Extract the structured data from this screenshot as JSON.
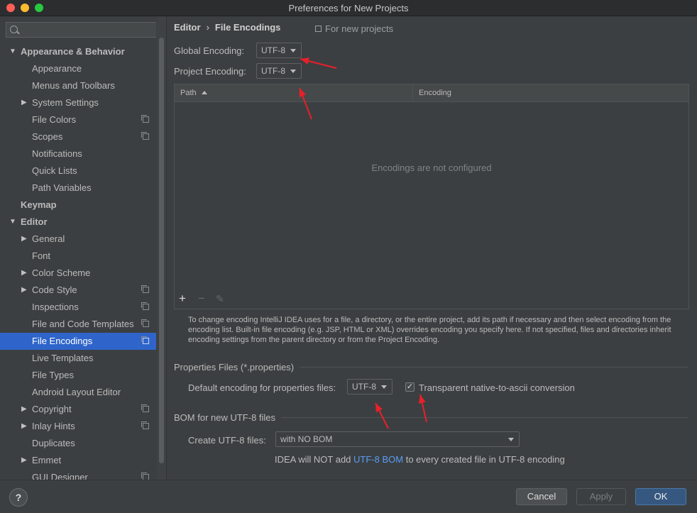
{
  "window": {
    "title": "Preferences for New Projects"
  },
  "search": {
    "placeholder": ""
  },
  "sidebar": {
    "items": [
      {
        "label": "Appearance & Behavior",
        "level": 0,
        "expanded": true,
        "bold": true
      },
      {
        "label": "Appearance",
        "level": 1
      },
      {
        "label": "Menus and Toolbars",
        "level": 1
      },
      {
        "label": "System Settings",
        "level": 1,
        "collapsed": true
      },
      {
        "label": "File Colors",
        "level": 1,
        "copy": true
      },
      {
        "label": "Scopes",
        "level": 1,
        "copy": true
      },
      {
        "label": "Notifications",
        "level": 1
      },
      {
        "label": "Quick Lists",
        "level": 1
      },
      {
        "label": "Path Variables",
        "level": 1
      },
      {
        "label": "Keymap",
        "level": 0,
        "bold": true
      },
      {
        "label": "Editor",
        "level": 0,
        "expanded": true,
        "bold": true
      },
      {
        "label": "General",
        "level": 1,
        "collapsed": true
      },
      {
        "label": "Font",
        "level": 1
      },
      {
        "label": "Color Scheme",
        "level": 1,
        "collapsed": true
      },
      {
        "label": "Code Style",
        "level": 1,
        "collapsed": true,
        "copy": true
      },
      {
        "label": "Inspections",
        "level": 1,
        "copy": true
      },
      {
        "label": "File and Code Templates",
        "level": 1,
        "copy": true
      },
      {
        "label": "File Encodings",
        "level": 1,
        "copy": true,
        "selected": true
      },
      {
        "label": "Live Templates",
        "level": 1
      },
      {
        "label": "File Types",
        "level": 1
      },
      {
        "label": "Android Layout Editor",
        "level": 1
      },
      {
        "label": "Copyright",
        "level": 1,
        "collapsed": true,
        "copy": true
      },
      {
        "label": "Inlay Hints",
        "level": 1,
        "collapsed": true,
        "copy": true
      },
      {
        "label": "Duplicates",
        "level": 1
      },
      {
        "label": "Emmet",
        "level": 1,
        "collapsed": true
      },
      {
        "label": "GUI Designer",
        "level": 1,
        "copy": true
      }
    ]
  },
  "breadcrumb": {
    "parent": "Editor",
    "separator": "›",
    "current": "File Encodings",
    "scope_note": "For new projects"
  },
  "global_encoding": {
    "label": "Global Encoding:",
    "value": "UTF-8"
  },
  "project_encoding": {
    "label": "Project Encoding:",
    "value": "UTF-8"
  },
  "table": {
    "columns": [
      "Path",
      "Encoding"
    ],
    "empty_text": "Encodings are not configured",
    "toolbar": {
      "add": "+",
      "remove": "−",
      "edit": "✎"
    }
  },
  "help_text": "To change encoding IntelliJ IDEA uses for a file, a directory, or the entire project, add its path if necessary and then select encoding from the encoding list. Built-in file encoding (e.g. JSP, HTML or XML) overrides encoding you specify here. If not specified, files and directories inherit encoding settings from the parent directory or from the Project Encoding.",
  "properties": {
    "section_title": "Properties Files (*.properties)",
    "default_label": "Default encoding for properties files:",
    "default_value": "UTF-8",
    "transparent_label": "Transparent native-to-ascii conversion",
    "transparent_checked": true,
    "check_mark": "✓"
  },
  "bom": {
    "section_title": "BOM for new UTF-8 files",
    "create_label": "Create UTF-8 files:",
    "create_value": "with NO BOM",
    "note_prefix": "IDEA will NOT add ",
    "note_link": "UTF-8 BOM",
    "note_suffix": " to every created file in UTF-8 encoding"
  },
  "footer": {
    "help": "?",
    "cancel": "Cancel",
    "apply": "Apply",
    "ok": "OK"
  },
  "colors": {
    "accent": "#2f65ca",
    "annotation": "#e8202a",
    "link": "#589df6"
  }
}
